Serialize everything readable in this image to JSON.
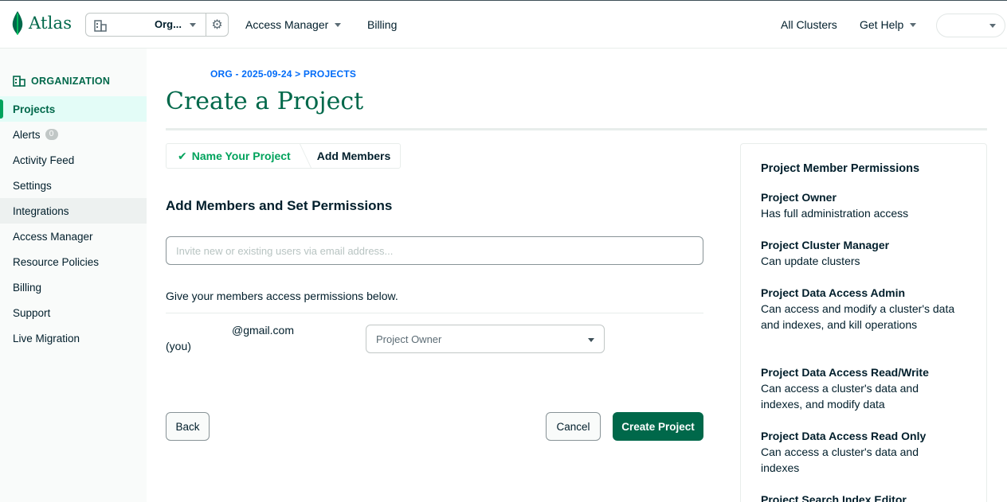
{
  "app": {
    "logo_text": "Atlas"
  },
  "topbar": {
    "org_name": "Org...",
    "nav": [
      {
        "label": "Access Manager",
        "has_dropdown": true
      },
      {
        "label": "Billing",
        "has_dropdown": false
      }
    ],
    "right_nav": [
      {
        "label": "All Clusters",
        "has_dropdown": false
      },
      {
        "label": "Get Help",
        "has_dropdown": true
      }
    ]
  },
  "sidebar": {
    "header": "ORGANIZATION",
    "items": [
      {
        "label": "Projects",
        "active": true
      },
      {
        "label": "Alerts",
        "badge": "0"
      },
      {
        "label": "Activity Feed"
      },
      {
        "label": "Settings"
      },
      {
        "label": "Integrations",
        "hovered": true
      },
      {
        "label": "Access Manager"
      },
      {
        "label": "Resource Policies"
      },
      {
        "label": "Billing"
      },
      {
        "label": "Support"
      },
      {
        "label": "Live Migration"
      }
    ]
  },
  "main": {
    "breadcrumb": "ORG - 2025-09-24 > PROJECTS",
    "title": "Create a Project",
    "steps": [
      {
        "label": "Name Your Project",
        "status": "done"
      },
      {
        "label": "Add Members",
        "status": "current"
      }
    ],
    "section_title": "Add Members and Set Permissions",
    "invite_placeholder": "Invite new or existing users via email address...",
    "give_text": "Give your members access permissions below.",
    "member": {
      "email": "@gmail.com",
      "you_label": "(you)",
      "role": "Project Owner"
    },
    "buttons": {
      "back": "Back",
      "cancel": "Cancel",
      "create": "Create Project"
    }
  },
  "permissions": {
    "title": "Project Member Permissions",
    "items": [
      {
        "name": "Project Owner",
        "desc": "Has full administration access"
      },
      {
        "name": "Project Cluster Manager",
        "desc": "Can update clusters"
      },
      {
        "name": "Project Data Access Admin",
        "desc": "Can access and modify a cluster's data and indexes, and kill operations"
      },
      {
        "name": "Project Data Access Read/Write",
        "desc": "Can access a cluster's data and indexes, and modify data"
      },
      {
        "name": "Project Data Access Read Only",
        "desc": "Can access a cluster's data and indexes"
      },
      {
        "name": "Project Search Index Editor",
        "desc": ""
      }
    ]
  },
  "colors": {
    "brand_green": "#00684a",
    "accent_green": "#00a35c",
    "link_blue": "#016bf8",
    "text_dark": "#001e2b"
  }
}
